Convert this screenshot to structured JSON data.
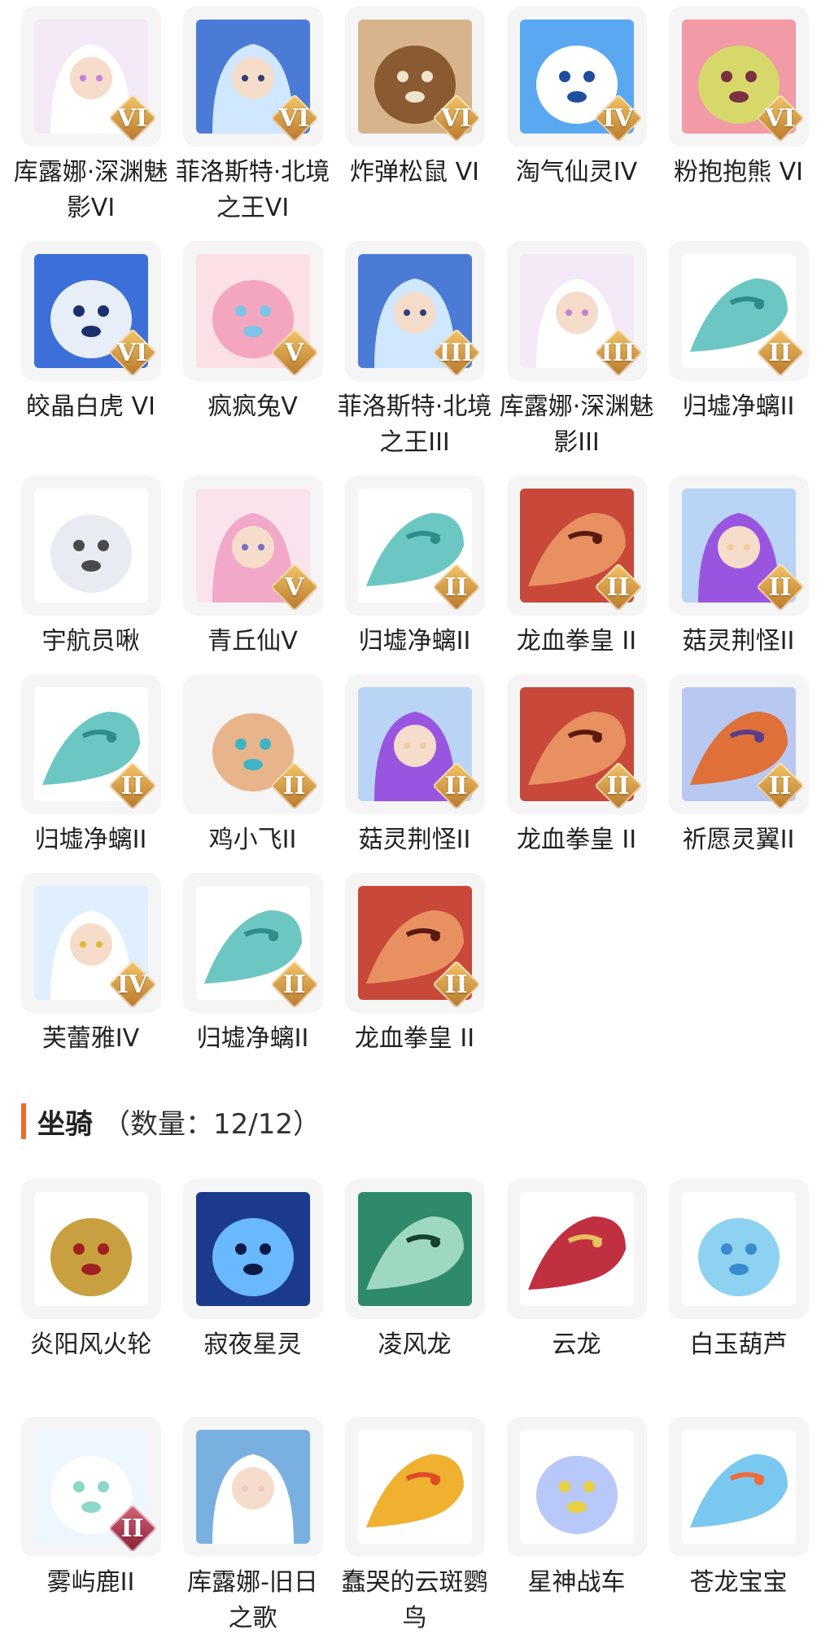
{
  "pets": [
    {
      "name": "库露娜·深渊魅影VI",
      "icon": "white-haired-girl-icon",
      "badge": "VI",
      "palette": [
        "#f3e9f7",
        "#ffffff",
        "#c77fd9"
      ]
    },
    {
      "name": "菲洛斯特·北境之王VI",
      "icon": "ice-knight-icon",
      "badge": "VI",
      "palette": [
        "#4c7bd6",
        "#cfe8ff",
        "#2d3f78"
      ]
    },
    {
      "name": "炸弹松鼠 VI",
      "icon": "squirrel-icon",
      "badge": "VI",
      "palette": [
        "#d8b48c",
        "#8a5a32",
        "#f1e4cf"
      ]
    },
    {
      "name": "淘气仙灵IV",
      "icon": "blue-puppy-icon",
      "badge": "IV",
      "palette": [
        "#5aa8f0",
        "#ffffff",
        "#1f4f9c"
      ]
    },
    {
      "name": "粉抱抱熊 VI",
      "icon": "pink-bear-icon",
      "badge": "VI",
      "palette": [
        "#f29aa6",
        "#d7d86a",
        "#7a3040"
      ]
    },
    {
      "name": "皎晶白虎 VI",
      "icon": "white-tiger-icon",
      "badge": "VI",
      "palette": [
        "#3c6fd8",
        "#e8eef8",
        "#1a2f6b"
      ]
    },
    {
      "name": "疯疯兔V",
      "icon": "pink-rabbit-icon",
      "badge": "V",
      "palette": [
        "#fbe0e6",
        "#f5a6bf",
        "#7fc3e8"
      ]
    },
    {
      "name": "菲洛斯特·北境之王III",
      "icon": "ice-knight-icon",
      "badge": "III",
      "palette": [
        "#4c7bd6",
        "#cfe8ff",
        "#2d3f78"
      ]
    },
    {
      "name": "库露娜·深渊魅影III",
      "icon": "white-haired-girl-icon",
      "badge": "III",
      "palette": [
        "#f3e9f7",
        "#ffffff",
        "#c77fd9"
      ]
    },
    {
      "name": "归墟净螭II",
      "icon": "teal-dragon-icon",
      "badge": "II",
      "palette": [
        "#ffffff",
        "#6cc7c3",
        "#2f8c8a"
      ]
    },
    {
      "name": "宇航员啾",
      "icon": "astronaut-cow-icon",
      "badge": "",
      "palette": [
        "#ffffff",
        "#e8ecf2",
        "#4a4a4a"
      ]
    },
    {
      "name": "青丘仙V",
      "icon": "fox-fairy-icon",
      "badge": "V",
      "palette": [
        "#fbe3ee",
        "#f2a8c8",
        "#7a6cc8"
      ]
    },
    {
      "name": "归墟净螭II",
      "icon": "teal-dragon-icon",
      "badge": "II",
      "palette": [
        "#ffffff",
        "#6cc7c3",
        "#2f8c8a"
      ]
    },
    {
      "name": "龙血拳皇 II",
      "icon": "red-bull-icon",
      "badge": "II",
      "palette": [
        "#c8483a",
        "#e89060",
        "#5a1a12"
      ]
    },
    {
      "name": "菇灵荆怪II",
      "icon": "purple-elf-icon",
      "badge": "II",
      "palette": [
        "#b9d4f5",
        "#9a55e0",
        "#f2cba0"
      ]
    },
    {
      "name": "归墟净螭II",
      "icon": "teal-dragon-icon",
      "badge": "II",
      "palette": [
        "#ffffff",
        "#6cc7c3",
        "#2f8c8a"
      ]
    },
    {
      "name": "鸡小飞II",
      "icon": "blue-chick-icon",
      "badge": "II",
      "palette": [
        "#f5f5f5",
        "#e8b48c",
        "#3fb4c4"
      ]
    },
    {
      "name": "菇灵荆怪II",
      "icon": "purple-elf-icon",
      "badge": "II",
      "palette": [
        "#b9d4f5",
        "#9a55e0",
        "#f2cba0"
      ]
    },
    {
      "name": "龙血拳皇 II",
      "icon": "red-bull-icon",
      "badge": "II",
      "palette": [
        "#c8483a",
        "#e89060",
        "#5a1a12"
      ]
    },
    {
      "name": "祈愿灵翼II",
      "icon": "griffin-icon",
      "badge": "II",
      "palette": [
        "#b8c8f0",
        "#e0703a",
        "#5a3e8c"
      ]
    },
    {
      "name": "芙蕾雅IV",
      "icon": "valkyrie-icon",
      "badge": "IV",
      "palette": [
        "#dfefff",
        "#ffffff",
        "#e8b830"
      ]
    },
    {
      "name": "归墟净螭II",
      "icon": "teal-dragon-icon",
      "badge": "II",
      "palette": [
        "#ffffff",
        "#6cc7c3",
        "#2f8c8a"
      ]
    },
    {
      "name": "龙血拳皇 II",
      "icon": "red-bull-icon",
      "badge": "II",
      "palette": [
        "#c8483a",
        "#e89060",
        "#5a1a12"
      ]
    }
  ],
  "mounts_section": {
    "title": "坐骑",
    "count": "（数量：12/12）"
  },
  "mounts": [
    {
      "name": "炎阳风火轮",
      "icon": "fire-wheel-icon",
      "badge": "",
      "palette": [
        "#ffffff",
        "#c8a040",
        "#a02020"
      ]
    },
    {
      "name": "寂夜星灵",
      "icon": "night-deer-icon",
      "badge": "",
      "palette": [
        "#1c3a8c",
        "#6ab8ff",
        "#0c1a48"
      ]
    },
    {
      "name": "凌风龙",
      "icon": "green-dragon-icon",
      "badge": "",
      "palette": [
        "#2f8a6c",
        "#9ed8c0",
        "#18402e"
      ]
    },
    {
      "name": "云龙",
      "icon": "red-dragon-icon",
      "badge": "",
      "palette": [
        "#ffffff",
        "#c03040",
        "#e8c060"
      ]
    },
    {
      "name": "白玉葫芦",
      "icon": "jade-gourd-icon",
      "badge": "",
      "palette": [
        "#ffffff",
        "#8ed2f2",
        "#3a8ad0"
      ]
    },
    {
      "name": "雾屿鹿II",
      "icon": "white-deer-icon",
      "badge": "II",
      "palette": [
        "#eef6ff",
        "#ffffff",
        "#8cd8c8"
      ]
    },
    {
      "name": "库露娜-旧日之歌",
      "icon": "sheep-girl-icon",
      "badge": "",
      "palette": [
        "#7ab0e0",
        "#ffffff",
        "#f2c8c8"
      ]
    },
    {
      "name": "蠢哭的云斑鹦鸟",
      "icon": "parrot-icon",
      "badge": "",
      "palette": [
        "#ffffff",
        "#f0b030",
        "#e04a28"
      ]
    },
    {
      "name": "星神战车",
      "icon": "star-horse-icon",
      "badge": "",
      "palette": [
        "#ffffff",
        "#b8c8f8",
        "#e8d040"
      ]
    },
    {
      "name": "苍龙宝宝",
      "icon": "baby-dragon-icon",
      "badge": "",
      "palette": [
        "#ffffff",
        "#7ac8f0",
        "#f06a3a"
      ]
    }
  ]
}
